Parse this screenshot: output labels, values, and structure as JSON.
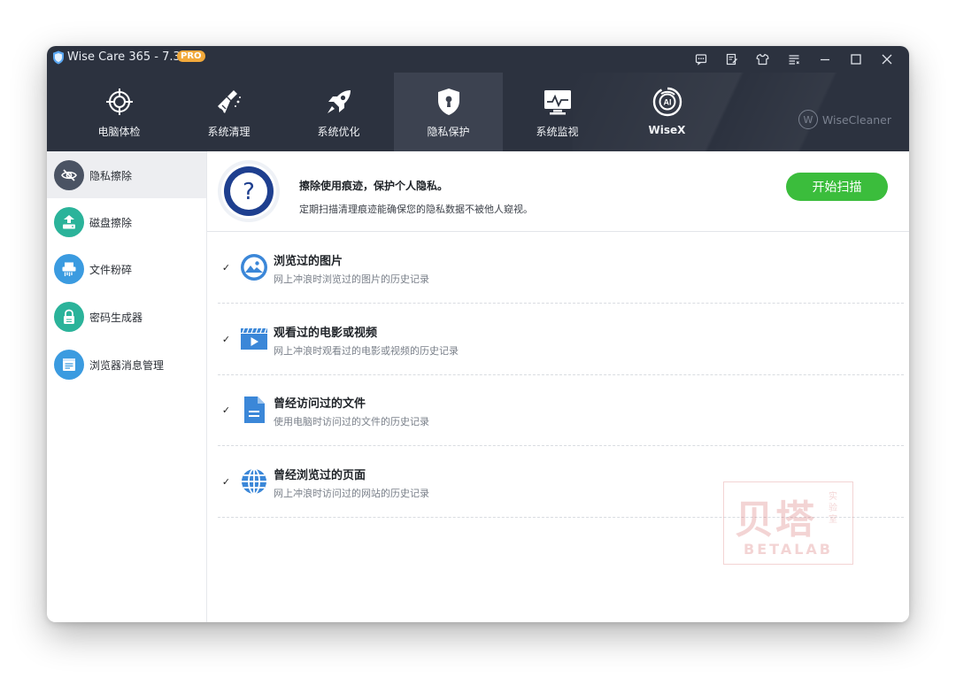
{
  "window": {
    "title": "Wise Care 365 - 7.3.1",
    "badge": "PRO"
  },
  "nav": {
    "tabs": [
      {
        "label": "电脑体检",
        "icon": "crosshair-icon"
      },
      {
        "label": "系统清理",
        "icon": "broom-icon"
      },
      {
        "label": "系统优化",
        "icon": "rocket-icon"
      },
      {
        "label": "隐私保护",
        "icon": "shield-keyhole-icon",
        "active": true
      },
      {
        "label": "系统监视",
        "icon": "monitor-icon"
      },
      {
        "label": "WiseX",
        "icon": "ai-icon"
      }
    ],
    "brand": "WiseCleaner",
    "brand_mark": "W"
  },
  "sidebar": {
    "items": [
      {
        "label": "隐私擦除",
        "icon": "eye-off-icon",
        "color": "#4a5363",
        "active": true
      },
      {
        "label": "磁盘擦除",
        "icon": "disk-erase-icon",
        "color": "#2bb39a"
      },
      {
        "label": "文件粉碎",
        "icon": "shredder-icon",
        "color": "#3b9be0"
      },
      {
        "label": "密码生成器",
        "icon": "lock-icon",
        "color": "#2bb39a"
      },
      {
        "label": "浏览器消息管理",
        "icon": "browser-message-icon",
        "color": "#3b9be0"
      }
    ]
  },
  "header": {
    "title": "擦除使用痕迹，保护个人隐私。",
    "subtitle": "定期扫描清理痕迹能确保您的隐私数据不被他人窥视。",
    "scan_button": "开始扫描",
    "help_symbol": "?"
  },
  "items": [
    {
      "title": "浏览过的图片",
      "desc": "网上冲浪时浏览过的图片的历史记录",
      "icon": "image-icon",
      "checked": true
    },
    {
      "title": "观看过的电影或视频",
      "desc": "网上冲浪时观看过的电影或视频的历史记录",
      "icon": "video-icon",
      "checked": true
    },
    {
      "title": "曾经访问过的文件",
      "desc": "使用电脑时访问过的文件的历史记录",
      "icon": "document-icon",
      "checked": true
    },
    {
      "title": "曾经浏览过的页面",
      "desc": "网上冲浪时访问过的网站的历史记录",
      "icon": "globe-icon",
      "checked": true
    }
  ],
  "checkmark": "✓",
  "watermark": {
    "main": "贝塔",
    "side": "实验室",
    "en": "BETALAB"
  },
  "colors": {
    "chrome": "#2c323f",
    "accent_green": "#3bbd3c",
    "icon_blue": "#3b87d8",
    "help_navy": "#1e3f8f"
  }
}
